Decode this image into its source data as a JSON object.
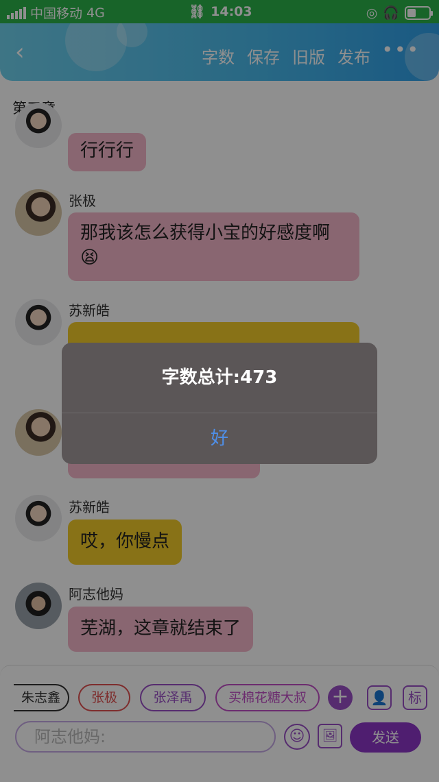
{
  "status_bar": {
    "carrier": "中国移动",
    "network": "4G",
    "time": "14:03"
  },
  "header": {
    "actions": [
      "字数",
      "保存",
      "旧版",
      "发布"
    ],
    "more": "•••"
  },
  "chapter_title": "第三章",
  "messages": [
    {
      "name": "",
      "text": "行行行",
      "color": "pink"
    },
    {
      "name": "张极",
      "text": "那我该怎么获得小宝的好感度啊😫",
      "color": "pink"
    },
    {
      "name": "苏新皓",
      "text": "",
      "color": "yellow"
    },
    {
      "name": "苏新皓",
      "text": "哎，你慢点",
      "color": "yellow"
    },
    {
      "name": "阿志他妈",
      "text": "芜湖，这章就结束了",
      "color": "pink"
    }
  ],
  "characters": [
    {
      "label": "朱志鑫",
      "color": "#333333"
    },
    {
      "label": "张极",
      "color": "#e05050"
    },
    {
      "label": "张泽禹",
      "color": "#9a4fc6"
    },
    {
      "label": "买棉花糖大叔",
      "color": "#c04fc6"
    }
  ],
  "toolbar": {
    "tag_icon_label": "标"
  },
  "composer": {
    "placeholder": "阿志他妈:",
    "send_label": "发送"
  },
  "dialog": {
    "message": "字数总计:473",
    "ok_label": "好"
  }
}
